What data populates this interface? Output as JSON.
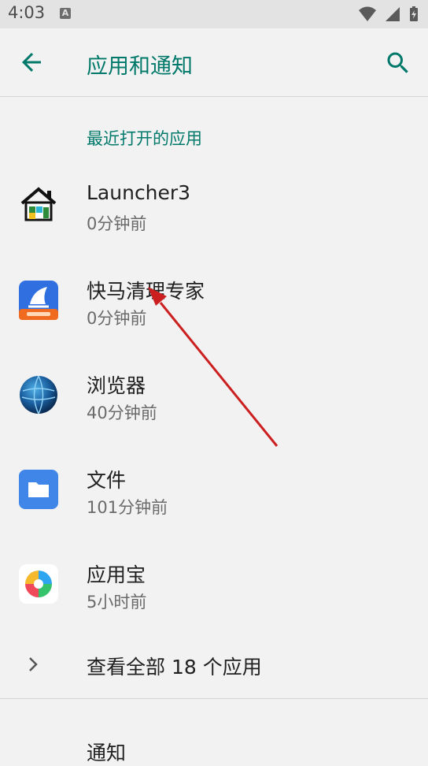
{
  "status_bar": {
    "time": "4:03",
    "notification_icon": "A"
  },
  "app_bar": {
    "title": "应用和通知",
    "back_icon": "arrow-back-icon",
    "search_icon": "search-icon"
  },
  "recent_apps": {
    "header": "最近打开的应用",
    "items": [
      {
        "name": "Launcher3",
        "time": "0分钟前",
        "icon": "launcher3-house-icon"
      },
      {
        "name": "快马清理专家",
        "time": "0分钟前",
        "icon": "broom-cleaner-icon"
      },
      {
        "name": "浏览器",
        "time": "40分钟前",
        "icon": "globe-browser-icon"
      },
      {
        "name": "文件",
        "time": "101分钟前",
        "icon": "folder-icon"
      },
      {
        "name": "应用宝",
        "time": "5小时前",
        "icon": "yingyongbao-icon"
      }
    ]
  },
  "see_all": {
    "label": "查看全部 18 个应用"
  },
  "notifications": {
    "label": "通知"
  },
  "colors": {
    "accent": "#00796b",
    "background": "#f2f2f2",
    "annotation_arrow": "#cc2020"
  }
}
